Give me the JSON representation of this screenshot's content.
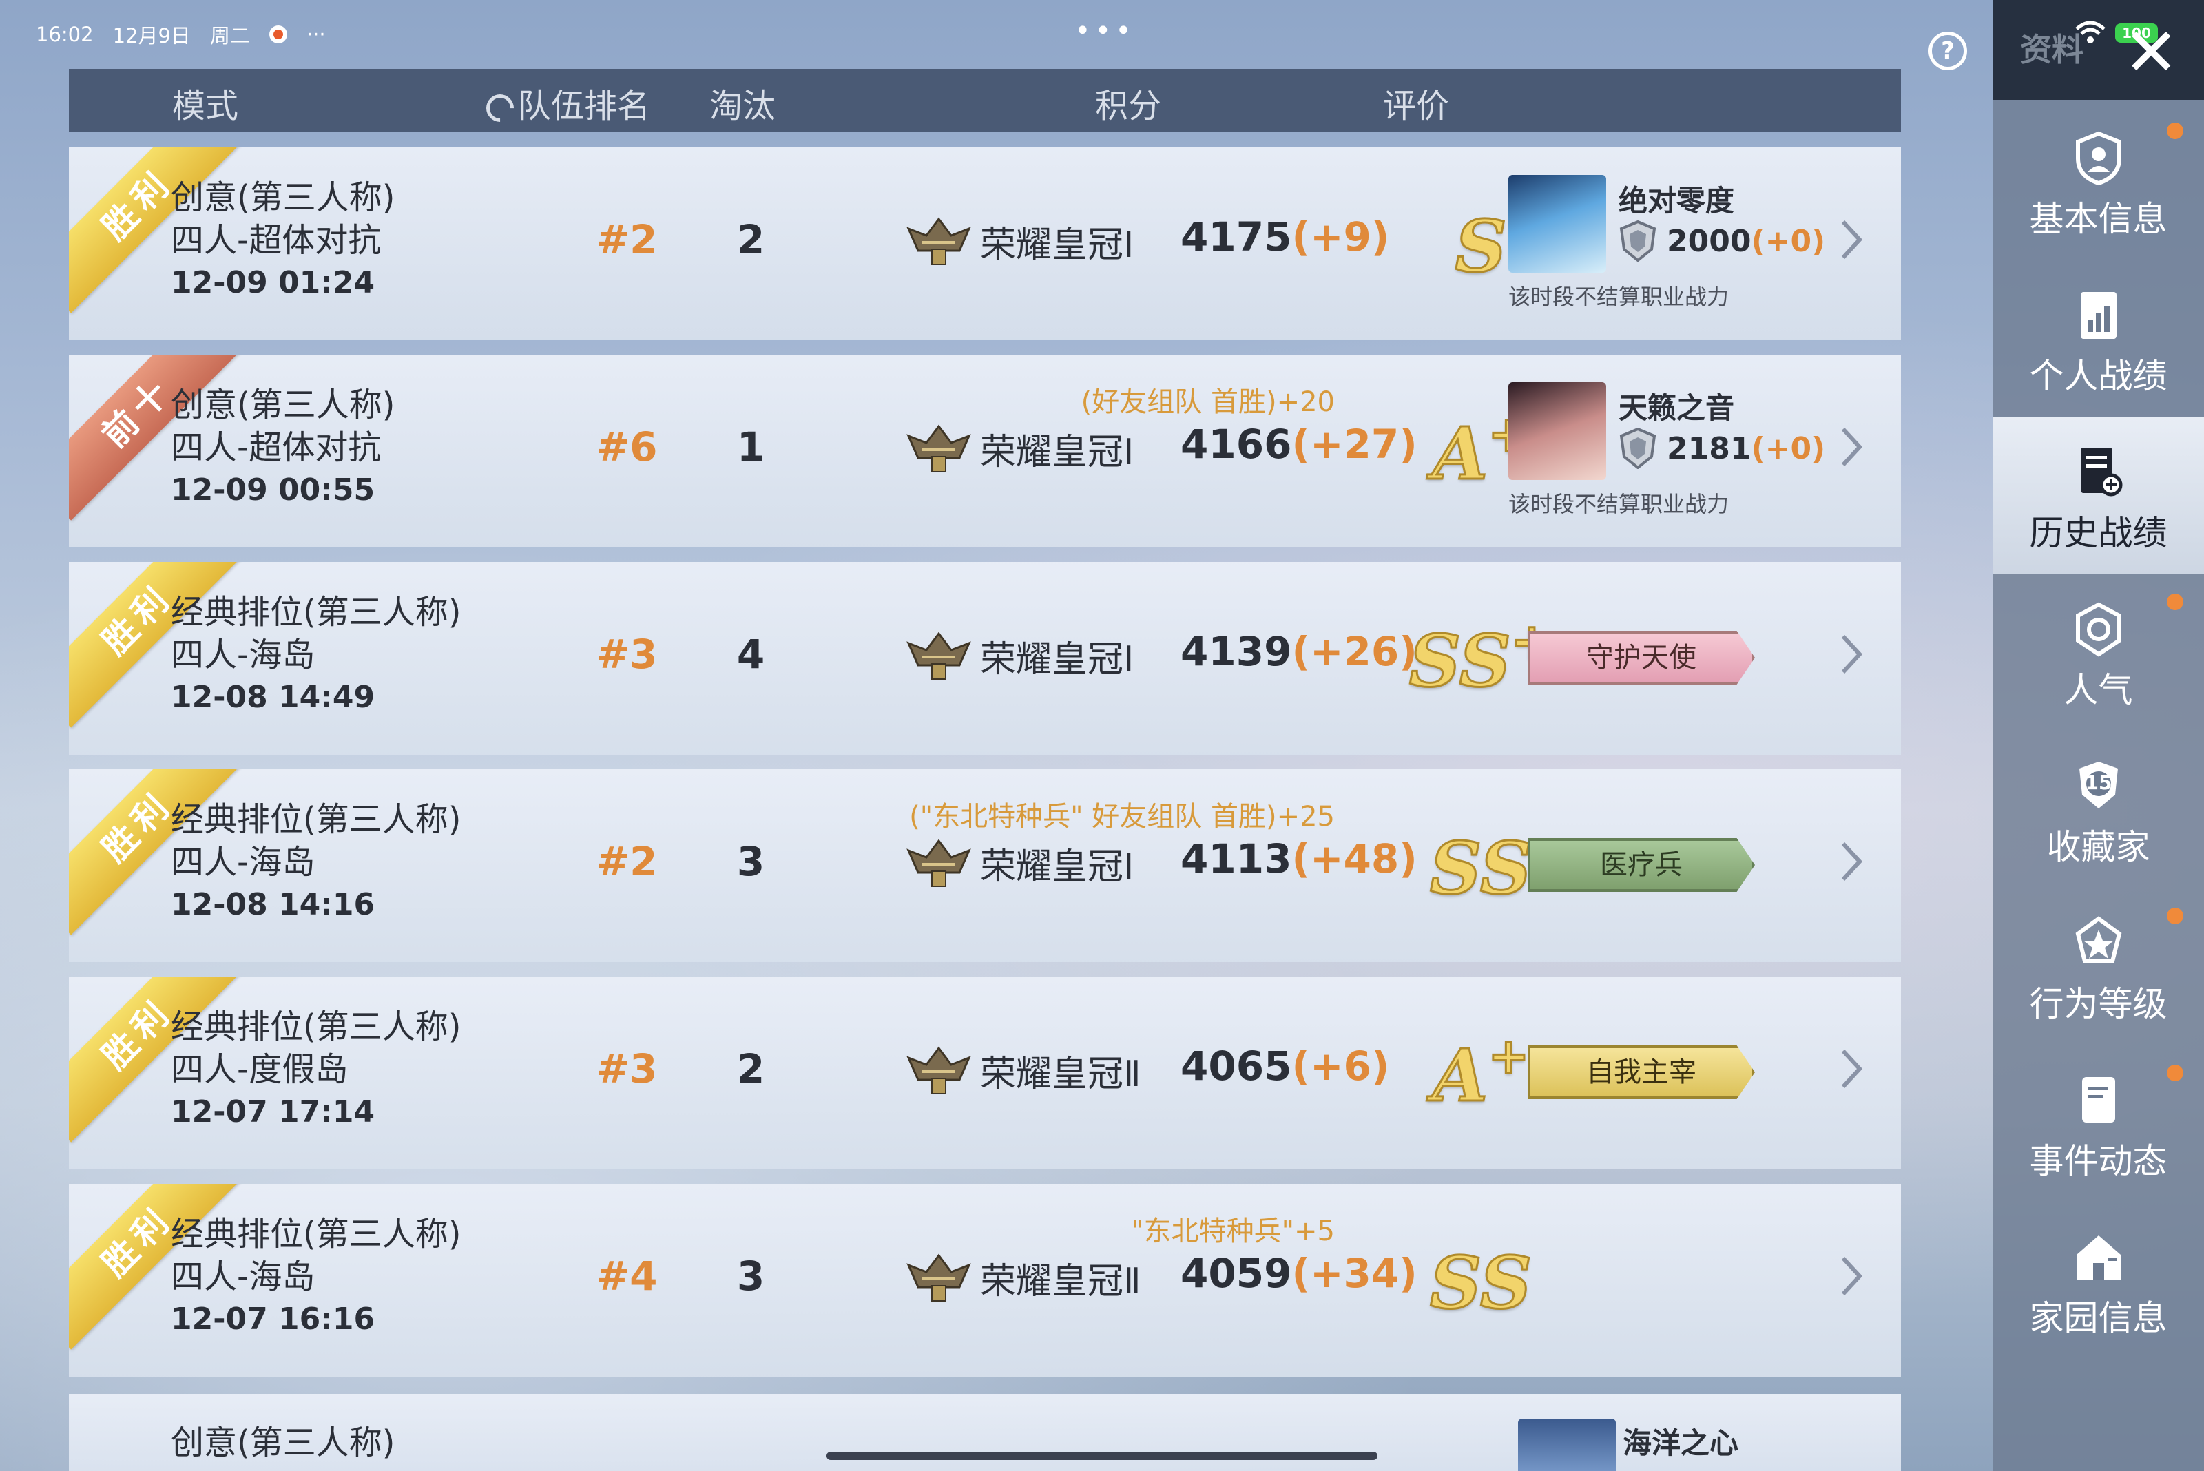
{
  "status_bar": {
    "time": "16:02",
    "date": "12月9日",
    "weekday": "周二",
    "more": "···"
  },
  "top_menu_dots": "•••",
  "help_label": "?",
  "header": {
    "mode": "模式",
    "team_rank": "队伍排名",
    "kills": "淘汰",
    "score": "积分",
    "rating": "评价"
  },
  "rows": [
    {
      "result": "胜利",
      "mode": "创意(第三人称)",
      "submode": "四人-超体对抗",
      "time": "12-09 01:24",
      "rank": "#2",
      "kills": "2",
      "bonus": "",
      "tier": "荣耀皇冠Ⅰ",
      "score": "4175",
      "delta": "(+9)",
      "grade": "S",
      "grade_plus": "",
      "mvp": {
        "name": "绝对零度",
        "power": "2000",
        "power_delta": "(+0)",
        "note": "该时段不结算职业战力"
      }
    },
    {
      "result": "前十",
      "mode": "创意(第三人称)",
      "submode": "四人-超体对抗",
      "time": "12-09 00:55",
      "rank": "#6",
      "kills": "1",
      "bonus": "(好友组队 首胜)+20",
      "tier": "荣耀皇冠Ⅰ",
      "score": "4166",
      "delta": "(+27)",
      "grade": "A",
      "grade_plus": "+",
      "mvp": {
        "name": "天籁之音",
        "power": "2181",
        "power_delta": "(+0)",
        "note": "该时段不结算职业战力"
      }
    },
    {
      "result": "胜利",
      "mode": "经典排位(第三人称)",
      "submode": "四人-海岛",
      "time": "12-08 14:49",
      "rank": "#3",
      "kills": "4",
      "bonus": "",
      "tier": "荣耀皇冠Ⅰ",
      "score": "4139",
      "delta": "(+26)",
      "grade": "SS",
      "grade_plus": "+",
      "title_badge": "守护天使"
    },
    {
      "result": "胜利",
      "mode": "经典排位(第三人称)",
      "submode": "四人-海岛",
      "time": "12-08 14:16",
      "rank": "#2",
      "kills": "3",
      "bonus": "(\"东北特种兵\" 好友组队 首胜)+25",
      "tier": "荣耀皇冠Ⅰ",
      "score": "4113",
      "delta": "(+48)",
      "grade": "SS",
      "grade_plus": "",
      "title_badge": "医疗兵"
    },
    {
      "result": "胜利",
      "mode": "经典排位(第三人称)",
      "submode": "四人-度假岛",
      "time": "12-07 17:14",
      "rank": "#3",
      "kills": "2",
      "bonus": "",
      "tier": "荣耀皇冠Ⅱ",
      "score": "4065",
      "delta": "(+6)",
      "grade": "A",
      "grade_plus": "+",
      "title_badge": "自我主宰"
    },
    {
      "result": "胜利",
      "mode": "经典排位(第三人称)",
      "submode": "四人-海岛",
      "time": "12-07 16:16",
      "rank": "#4",
      "kills": "3",
      "bonus": "\"东北特种兵\"+5",
      "tier": "荣耀皇冠Ⅱ",
      "score": "4059",
      "delta": "(+34)",
      "grade": "SS",
      "grade_plus": ""
    }
  ],
  "partial_row": {
    "mode": "创意(第三人称)",
    "mvp_name": "海洋之心"
  },
  "sidebar": {
    "title": "资料",
    "battery": "100",
    "items": [
      {
        "label": "基本信息",
        "icon": "profile-shield-icon",
        "notify": true
      },
      {
        "label": "个人战绩",
        "icon": "stats-doc-icon",
        "notify": false
      },
      {
        "label": "历史战绩",
        "icon": "history-doc-icon",
        "notify": false,
        "active": true
      },
      {
        "label": "人气",
        "icon": "popularity-icon",
        "notify": true
      },
      {
        "label": "收藏家",
        "icon": "collector-badge-icon",
        "notify": false,
        "badge": "15"
      },
      {
        "label": "行为等级",
        "icon": "behavior-star-icon",
        "notify": true
      },
      {
        "label": "事件动态",
        "icon": "event-note-icon",
        "notify": true
      },
      {
        "label": "家园信息",
        "icon": "home-icon",
        "notify": false
      }
    ]
  },
  "colors": {
    "accent_orange": "#e08a3a",
    "bonus_gold": "#d89a3b",
    "header_bg": "#4a5a75",
    "sidebar_bg": "#6c7a90"
  }
}
